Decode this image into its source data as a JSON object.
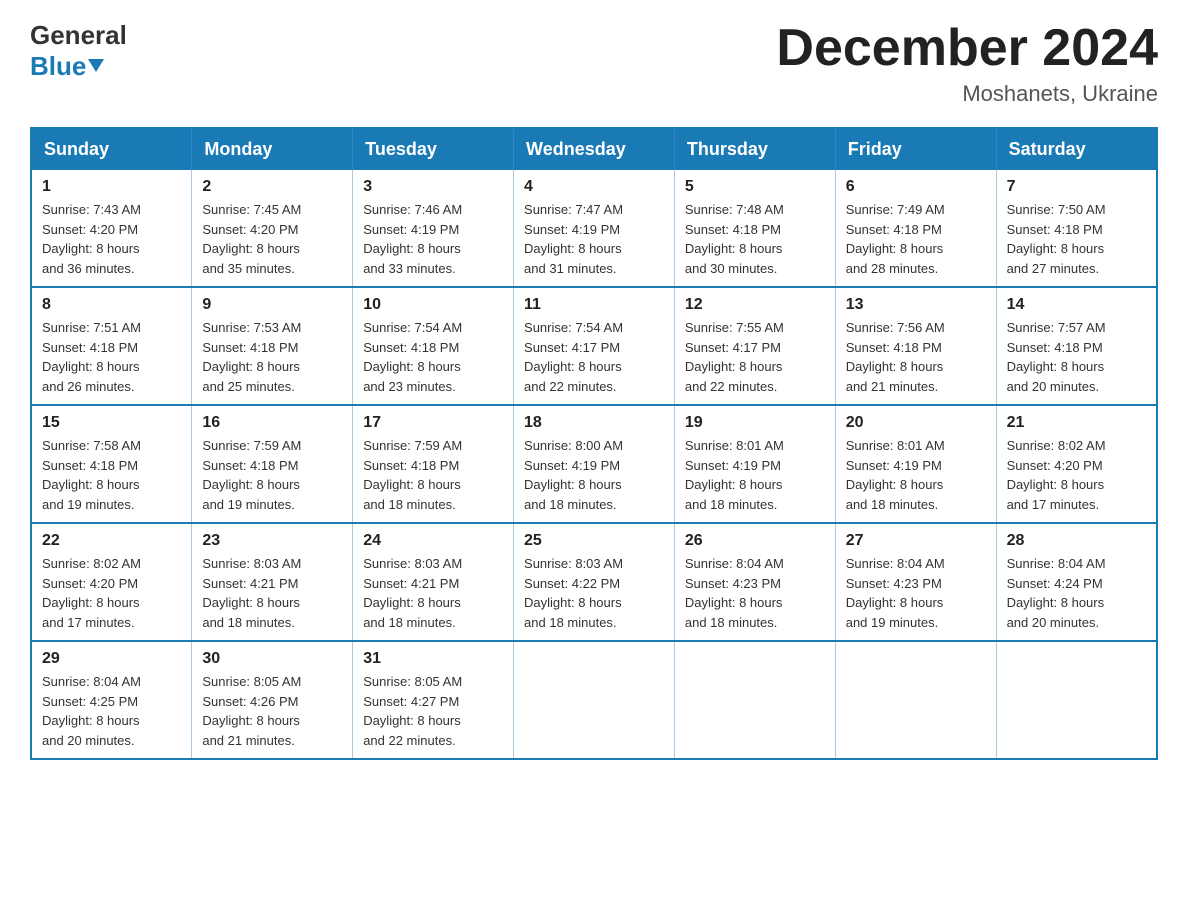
{
  "header": {
    "logo_line1": "General",
    "logo_line2": "Blue",
    "month_title": "December 2024",
    "location": "Moshanets, Ukraine"
  },
  "days_of_week": [
    "Sunday",
    "Monday",
    "Tuesday",
    "Wednesday",
    "Thursday",
    "Friday",
    "Saturday"
  ],
  "weeks": [
    [
      {
        "day": "1",
        "sunrise": "7:43 AM",
        "sunset": "4:20 PM",
        "daylight": "8 hours and 36 minutes."
      },
      {
        "day": "2",
        "sunrise": "7:45 AM",
        "sunset": "4:20 PM",
        "daylight": "8 hours and 35 minutes."
      },
      {
        "day": "3",
        "sunrise": "7:46 AM",
        "sunset": "4:19 PM",
        "daylight": "8 hours and 33 minutes."
      },
      {
        "day": "4",
        "sunrise": "7:47 AM",
        "sunset": "4:19 PM",
        "daylight": "8 hours and 31 minutes."
      },
      {
        "day": "5",
        "sunrise": "7:48 AM",
        "sunset": "4:18 PM",
        "daylight": "8 hours and 30 minutes."
      },
      {
        "day": "6",
        "sunrise": "7:49 AM",
        "sunset": "4:18 PM",
        "daylight": "8 hours and 28 minutes."
      },
      {
        "day": "7",
        "sunrise": "7:50 AM",
        "sunset": "4:18 PM",
        "daylight": "8 hours and 27 minutes."
      }
    ],
    [
      {
        "day": "8",
        "sunrise": "7:51 AM",
        "sunset": "4:18 PM",
        "daylight": "8 hours and 26 minutes."
      },
      {
        "day": "9",
        "sunrise": "7:53 AM",
        "sunset": "4:18 PM",
        "daylight": "8 hours and 25 minutes."
      },
      {
        "day": "10",
        "sunrise": "7:54 AM",
        "sunset": "4:18 PM",
        "daylight": "8 hours and 23 minutes."
      },
      {
        "day": "11",
        "sunrise": "7:54 AM",
        "sunset": "4:17 PM",
        "daylight": "8 hours and 22 minutes."
      },
      {
        "day": "12",
        "sunrise": "7:55 AM",
        "sunset": "4:17 PM",
        "daylight": "8 hours and 22 minutes."
      },
      {
        "day": "13",
        "sunrise": "7:56 AM",
        "sunset": "4:18 PM",
        "daylight": "8 hours and 21 minutes."
      },
      {
        "day": "14",
        "sunrise": "7:57 AM",
        "sunset": "4:18 PM",
        "daylight": "8 hours and 20 minutes."
      }
    ],
    [
      {
        "day": "15",
        "sunrise": "7:58 AM",
        "sunset": "4:18 PM",
        "daylight": "8 hours and 19 minutes."
      },
      {
        "day": "16",
        "sunrise": "7:59 AM",
        "sunset": "4:18 PM",
        "daylight": "8 hours and 19 minutes."
      },
      {
        "day": "17",
        "sunrise": "7:59 AM",
        "sunset": "4:18 PM",
        "daylight": "8 hours and 18 minutes."
      },
      {
        "day": "18",
        "sunrise": "8:00 AM",
        "sunset": "4:19 PM",
        "daylight": "8 hours and 18 minutes."
      },
      {
        "day": "19",
        "sunrise": "8:01 AM",
        "sunset": "4:19 PM",
        "daylight": "8 hours and 18 minutes."
      },
      {
        "day": "20",
        "sunrise": "8:01 AM",
        "sunset": "4:19 PM",
        "daylight": "8 hours and 18 minutes."
      },
      {
        "day": "21",
        "sunrise": "8:02 AM",
        "sunset": "4:20 PM",
        "daylight": "8 hours and 17 minutes."
      }
    ],
    [
      {
        "day": "22",
        "sunrise": "8:02 AM",
        "sunset": "4:20 PM",
        "daylight": "8 hours and 17 minutes."
      },
      {
        "day": "23",
        "sunrise": "8:03 AM",
        "sunset": "4:21 PM",
        "daylight": "8 hours and 18 minutes."
      },
      {
        "day": "24",
        "sunrise": "8:03 AM",
        "sunset": "4:21 PM",
        "daylight": "8 hours and 18 minutes."
      },
      {
        "day": "25",
        "sunrise": "8:03 AM",
        "sunset": "4:22 PM",
        "daylight": "8 hours and 18 minutes."
      },
      {
        "day": "26",
        "sunrise": "8:04 AM",
        "sunset": "4:23 PM",
        "daylight": "8 hours and 18 minutes."
      },
      {
        "day": "27",
        "sunrise": "8:04 AM",
        "sunset": "4:23 PM",
        "daylight": "8 hours and 19 minutes."
      },
      {
        "day": "28",
        "sunrise": "8:04 AM",
        "sunset": "4:24 PM",
        "daylight": "8 hours and 20 minutes."
      }
    ],
    [
      {
        "day": "29",
        "sunrise": "8:04 AM",
        "sunset": "4:25 PM",
        "daylight": "8 hours and 20 minutes."
      },
      {
        "day": "30",
        "sunrise": "8:05 AM",
        "sunset": "4:26 PM",
        "daylight": "8 hours and 21 minutes."
      },
      {
        "day": "31",
        "sunrise": "8:05 AM",
        "sunset": "4:27 PM",
        "daylight": "8 hours and 22 minutes."
      },
      null,
      null,
      null,
      null
    ]
  ],
  "labels": {
    "sunrise": "Sunrise:",
    "sunset": "Sunset:",
    "daylight": "Daylight:"
  }
}
